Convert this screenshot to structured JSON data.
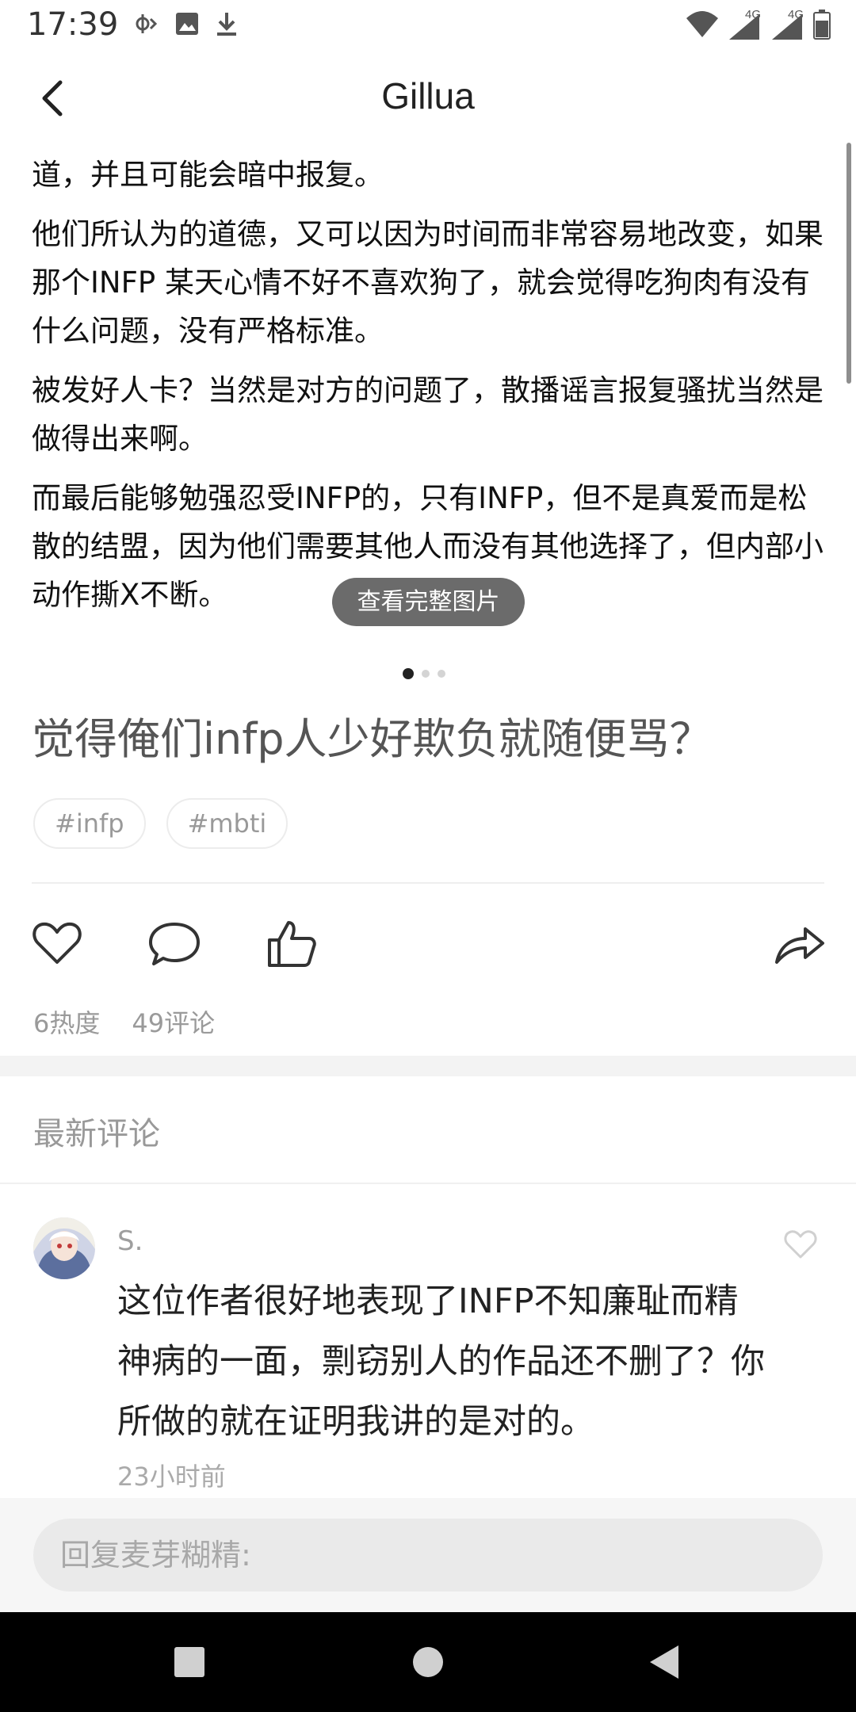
{
  "status_bar": {
    "time": "17:39",
    "network_labels": [
      "4G",
      "4G"
    ]
  },
  "header": {
    "title": "Gillua"
  },
  "post_image": {
    "paragraphs": [
      "道，并且可能会暗中报复。",
      "他们所认为的道德，又可以因为时间而非常容易地改变，如果那个INFP 某天心情不好不喜欢狗了，就会觉得吃狗肉有没有什么问题，没有严格标准。",
      "被发好人卡？当然是对方的问题了，散播谣言报复骚扰当然是做得出来啊。",
      "而最后能够勉强忍受INFP的，只有INFP，但不是真爱而是松散的结盟，因为他们需要其他人而没有其他选择了，但内部小动作撕X不断。"
    ],
    "view_full_label": "查看完整图片",
    "page_count": 3,
    "current_page": 1
  },
  "post": {
    "title": "觉得俺们infp人少好欺负就随便骂？",
    "tags": [
      "#infp",
      "#mbti"
    ],
    "heat": "6热度",
    "comments_count": "49评论"
  },
  "comments": {
    "header": "最新评论",
    "items": [
      {
        "author": "S.",
        "text": "这位作者很好地表现了INFP不知廉耻而精神病的一面，剽窃别人的作品还不删了？你所做的就在证明我讲的是对的。",
        "time": "23小时前"
      }
    ]
  },
  "reply": {
    "placeholder": "回复麦芽糊精:"
  },
  "colors": {
    "accent": "#222222",
    "muted": "#9a9a9a",
    "nav_bg": "#000000"
  }
}
